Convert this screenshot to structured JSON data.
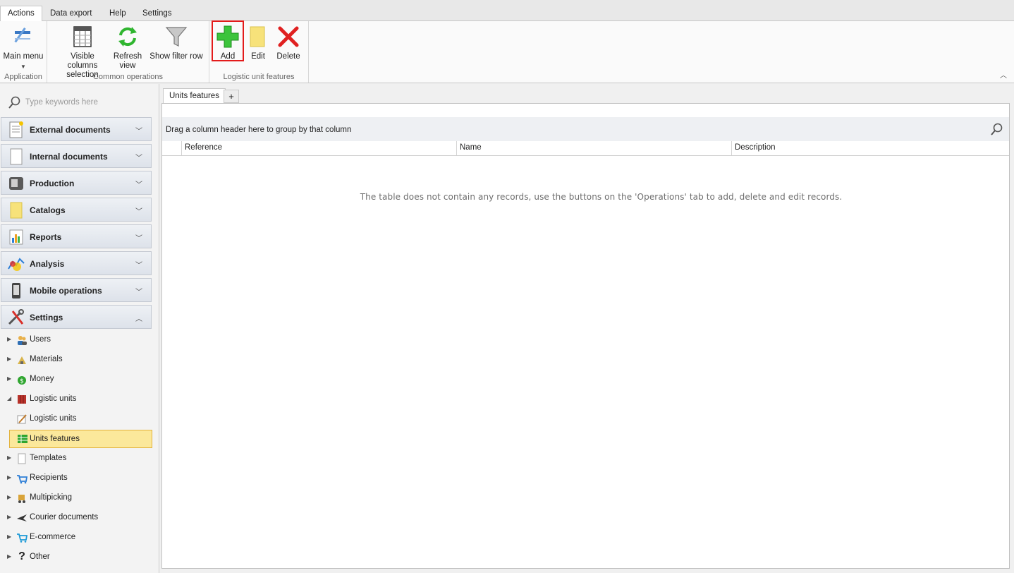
{
  "menu_tabs": [
    {
      "label": "Actions",
      "active": true
    },
    {
      "label": "Data export",
      "active": false
    },
    {
      "label": "Help",
      "active": false
    },
    {
      "label": "Settings",
      "active": false
    }
  ],
  "ribbon": {
    "groups": [
      {
        "label": "Application",
        "buttons": [
          {
            "label": "Main menu",
            "icon": "main-menu-icon"
          }
        ]
      },
      {
        "label": "Common operations",
        "buttons": [
          {
            "label": "Visible columns\nselection",
            "icon": "columns-icon"
          },
          {
            "label": "Refresh\nview",
            "icon": "refresh-icon"
          },
          {
            "label": "Show filter row",
            "icon": "filter-icon"
          }
        ]
      },
      {
        "label": "Logistic unit features",
        "buttons": [
          {
            "label": "Add",
            "icon": "add-icon"
          },
          {
            "label": "Edit",
            "icon": "edit-icon"
          },
          {
            "label": "Delete",
            "icon": "delete-icon"
          }
        ]
      }
    ],
    "highlight_color": "#e31b1b"
  },
  "sidebar": {
    "search_placeholder": "Type keywords here",
    "groups": [
      {
        "label": "External documents",
        "icon": "external-documents-icon",
        "expanded": false
      },
      {
        "label": "Internal documents",
        "icon": "internal-documents-icon",
        "expanded": false
      },
      {
        "label": "Production",
        "icon": "production-icon",
        "expanded": false
      },
      {
        "label": "Catalogs",
        "icon": "catalogs-icon",
        "expanded": false
      },
      {
        "label": "Reports",
        "icon": "reports-icon",
        "expanded": false
      },
      {
        "label": "Analysis",
        "icon": "analysis-icon",
        "expanded": false
      },
      {
        "label": "Mobile operations",
        "icon": "mobile-operations-icon",
        "expanded": false
      },
      {
        "label": "Settings",
        "icon": "settings-icon",
        "expanded": true
      }
    ],
    "tree": [
      {
        "label": "Users",
        "icon": "users-icon",
        "arrow": "collapsed",
        "level": 0
      },
      {
        "label": "Materials",
        "icon": "materials-icon",
        "arrow": "collapsed",
        "level": 0
      },
      {
        "label": "Money",
        "icon": "money-icon",
        "arrow": "collapsed",
        "level": 0
      },
      {
        "label": "Logistic units",
        "icon": "logistic-units-icon",
        "arrow": "expanded",
        "level": 0
      },
      {
        "label": "Logistic units",
        "icon": "pencil-icon",
        "arrow": "none",
        "level": 1
      },
      {
        "label": "Units features",
        "icon": "units-features-icon",
        "arrow": "none",
        "level": 1,
        "selected": true
      },
      {
        "label": "Templates",
        "icon": "templates-icon",
        "arrow": "collapsed",
        "level": 0
      },
      {
        "label": "Recipients",
        "icon": "recipients-icon",
        "arrow": "collapsed",
        "level": 0
      },
      {
        "label": "Multipicking",
        "icon": "multipicking-icon",
        "arrow": "collapsed",
        "level": 0
      },
      {
        "label": "Courier documents",
        "icon": "courier-icon",
        "arrow": "collapsed",
        "level": 0
      },
      {
        "label": "E-commerce",
        "icon": "ecommerce-icon",
        "arrow": "collapsed",
        "level": 0
      },
      {
        "label": "Other",
        "icon": "question-icon",
        "arrow": "collapsed",
        "level": 0
      }
    ]
  },
  "main": {
    "doc_tab": "Units features",
    "plus_label": "+",
    "group_hint": "Drag a column header here to group by that column",
    "columns": [
      "Reference",
      "Name",
      "Description"
    ],
    "empty_message": "The table does not contain any records, use the buttons on the 'Operations' tab to add, delete and edit records."
  }
}
